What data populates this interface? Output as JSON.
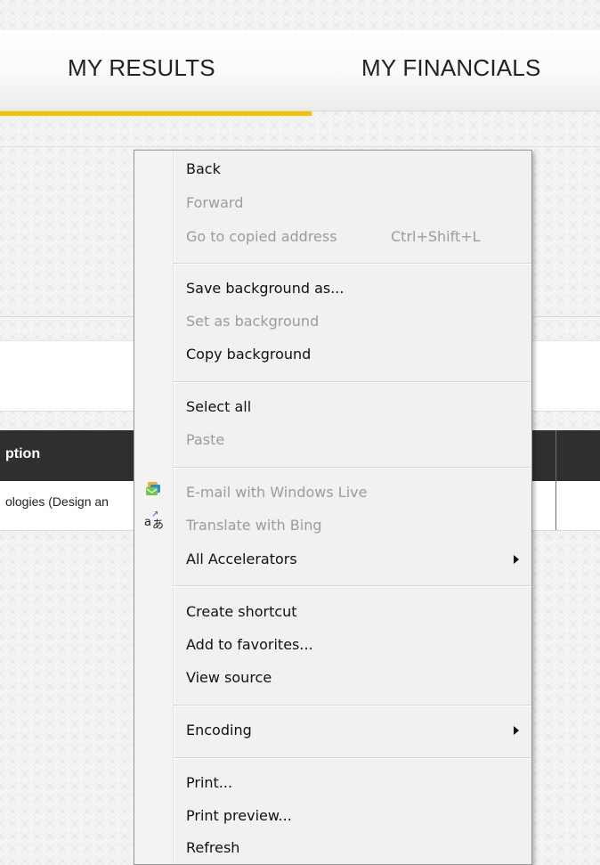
{
  "navigation": {
    "tabs": [
      {
        "label": "MY RESULTS",
        "active": true
      },
      {
        "label": "MY FINANCIALS",
        "active": false
      }
    ],
    "accent_color": "#f2c200"
  },
  "table": {
    "header": "ption",
    "rows": [
      "ologies (Design an"
    ]
  },
  "context_menu": {
    "items": [
      {
        "label": "Back",
        "disabled": false
      },
      {
        "label": "Forward",
        "disabled": true
      },
      {
        "label": "Go to copied address",
        "shortcut": "Ctrl+Shift+L",
        "disabled": true
      },
      {
        "label": "Save background as...",
        "disabled": false
      },
      {
        "label": "Set as background",
        "disabled": true
      },
      {
        "label": "Copy background",
        "disabled": false
      },
      {
        "label": "Select all",
        "disabled": false
      },
      {
        "label": "Paste",
        "disabled": true
      },
      {
        "label": "E-mail with Windows Live",
        "disabled": true,
        "icon": "windows-live-mail-icon"
      },
      {
        "label": "Translate with Bing",
        "disabled": true,
        "icon": "translate-icon"
      },
      {
        "label": "All Accelerators",
        "disabled": false,
        "submenu": true
      },
      {
        "label": "Create shortcut",
        "disabled": false
      },
      {
        "label": "Add to favorites...",
        "disabled": false
      },
      {
        "label": "View source",
        "disabled": false
      },
      {
        "label": "Encoding",
        "disabled": false,
        "submenu": true
      },
      {
        "label": "Print...",
        "disabled": false
      },
      {
        "label": "Print preview...",
        "disabled": false
      },
      {
        "label": "Refresh",
        "disabled": false
      }
    ]
  },
  "icons": {
    "translate_icon": {
      "latin": "a",
      "japanese": "あ"
    }
  }
}
